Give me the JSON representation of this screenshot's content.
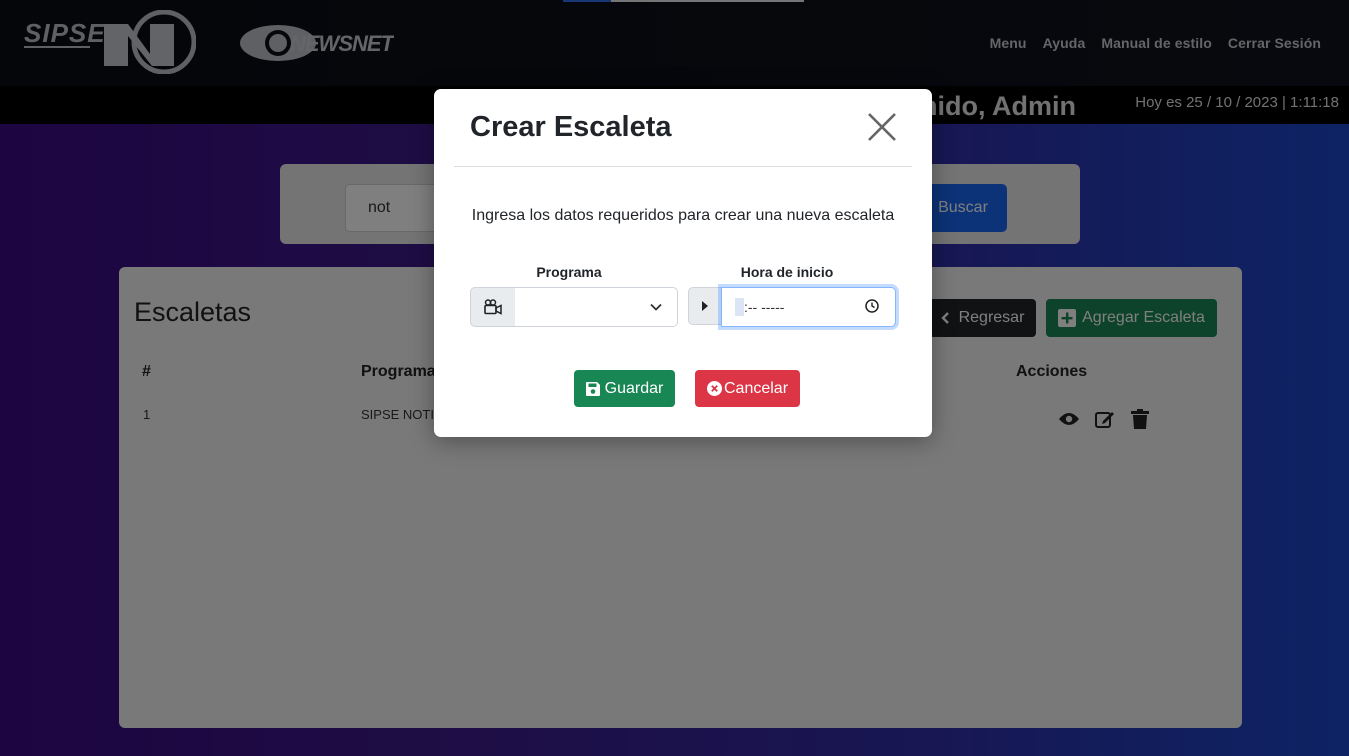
{
  "header": {
    "logo_sipse_alt": "SIPSE",
    "logo_newsnet_alt": "NEWSNET",
    "nav": [
      "Menu",
      "Ayuda",
      "Manual de estilo",
      "Cerrar Sesión"
    ]
  },
  "welcome": {
    "name": "enido, Admin",
    "date": "Hoy es 25 / 10 / 2023 | 1:11:18"
  },
  "search": {
    "value": "not",
    "button_label": "Buscar"
  },
  "escaletas": {
    "title": "Escaletas",
    "back_label": "Regresar",
    "add_label": "Agregar Escaleta",
    "columns": [
      "#",
      "Programa",
      "Acciones"
    ],
    "rows": [
      {
        "num": "1",
        "programa": "SIPSE NOTI"
      }
    ]
  },
  "modal": {
    "title": "Crear Escaleta",
    "description": "Ingresa los datos requeridos para crear una nueva escaleta",
    "programa_label": "Programa",
    "programa_value": "",
    "hora_label": "Hora de inicio",
    "hora_value": ":-- -----",
    "save_label": "Guardar",
    "cancel_label": "Cancelar"
  },
  "colors": {
    "save": "#198754",
    "cancel": "#dc3545",
    "search": "#1967f0",
    "back": "#212529"
  },
  "icons": {
    "close": "close-icon",
    "programa": "video-camera-icon",
    "hora": "play-icon",
    "clock": "clock-icon",
    "save": "floppy-disk-icon",
    "cancel": "x-circle-icon",
    "search": "magnifier-icon",
    "back": "chevron-left-icon",
    "add": "plus-square-icon",
    "view": "eye-icon",
    "edit": "edit-icon",
    "delete": "trash-icon"
  }
}
